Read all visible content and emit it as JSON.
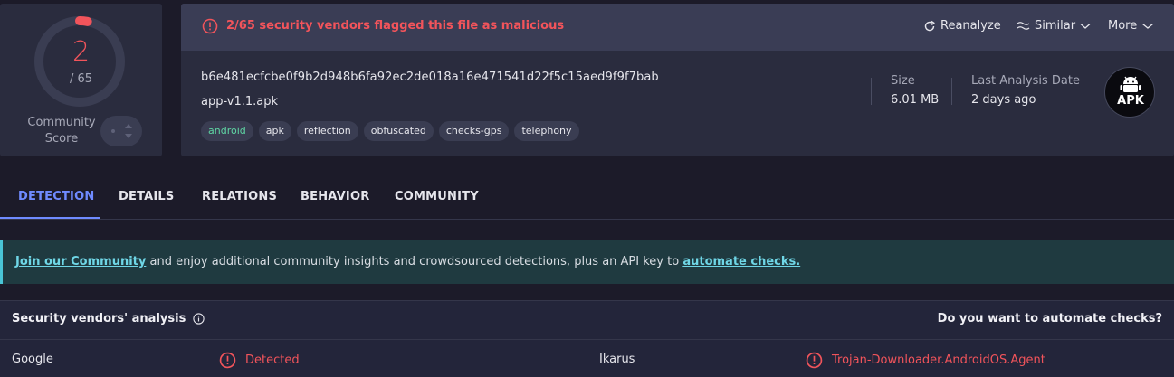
{
  "score": {
    "detections": "2",
    "total_label": "/ 65",
    "total": 65,
    "gauge_color": "#f2545b",
    "community_label": "Community Score"
  },
  "alert": {
    "text": "2/65 security vendors flagged this file as malicious",
    "icon": "alert-circle-icon"
  },
  "actions": {
    "reanalyze": "Reanalyze",
    "similar": "Similar",
    "more": "More"
  },
  "file": {
    "hash": "b6e481ecfcbe0f9b2d948b6fa92ec2de018a16e471541d22f5c15aed9f9f7bab",
    "name": "app-v1.1.apk",
    "tags": [
      "android",
      "apk",
      "reflection",
      "obfuscated",
      "checks-gps",
      "telephony"
    ],
    "size_label": "Size",
    "size_value": "6.01 MB",
    "date_label": "Last Analysis Date",
    "date_value": "2 days ago",
    "type_badge": "APK"
  },
  "tabs": [
    "DETECTION",
    "DETAILS",
    "RELATIONS",
    "BEHAVIOR",
    "COMMUNITY"
  ],
  "banner": {
    "link1": "Join our Community",
    "middle": " and enjoy additional community insights and crowdsourced detections, plus an API key to ",
    "link2": "automate checks."
  },
  "vendors": {
    "title": "Security vendors' analysis",
    "automate": "Do you want to automate checks?",
    "rows": [
      {
        "vendor": "Google",
        "result": "Detected"
      },
      {
        "vendor": "Ikarus",
        "result": "Trojan-Downloader.AndroidOS.Agent"
      }
    ]
  },
  "colors": {
    "malicious": "#f2545b",
    "accent": "#6f8bff",
    "banner_link": "#6fd6e6"
  }
}
